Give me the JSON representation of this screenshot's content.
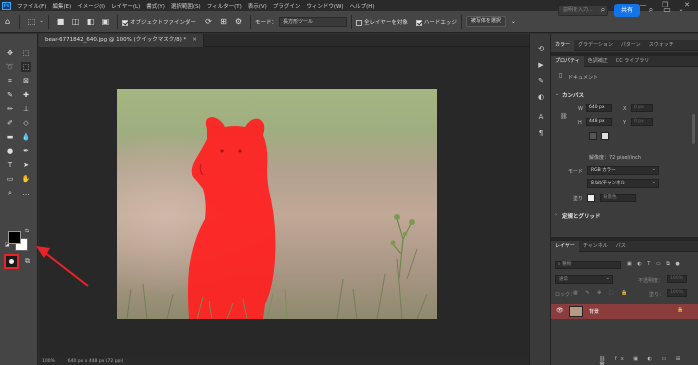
{
  "menu": {
    "logo": "Ps",
    "items": [
      "ファイル(F)",
      "編集(E)",
      "イメージ(I)",
      "レイヤー(L)",
      "書式(Y)",
      "選択範囲(S)",
      "フィルター(T)",
      "表示(V)",
      "プラグイン",
      "ウィンドウ(W)",
      "ヘルプ(H)"
    ]
  },
  "window_controls": [
    "—",
    "❐",
    "✕"
  ],
  "options_bar": {
    "object_finder_label": "オブジェクトファインダー",
    "mode_label": "モード：",
    "mode_value": "長方形ツール",
    "sample_all_layers_label": "全レイヤーを対象",
    "hard_edge_label": "ハードエッジ",
    "select_subject_label": "被写体を選択",
    "search_placeholder": "説明を入力...",
    "share_label": "共有"
  },
  "document": {
    "tab_title": "bear-6771842_640.jpg @ 100% (クイックマスク/8) *",
    "status_zoom": "100%",
    "status_info": "640 px x 448 px (72 ppi)"
  },
  "top_panel_tabs": [
    "カラー",
    "グラデーション",
    "パターン",
    "スウォッチ"
  ],
  "properties_tabs": [
    "プロパティ",
    "色調補正",
    "CC ライブラリ"
  ],
  "properties": {
    "doc_label": "ドキュメント",
    "canvas_heading": "カンバス",
    "w_label": "W",
    "w_value": "640 px",
    "x_label": "X",
    "x_value": "0 px",
    "h_label": "H",
    "h_value": "448 px",
    "y_label": "Y",
    "y_value": "0 px",
    "resolution": "解像度：72 pixel/inch",
    "mode_label": "モード",
    "mode_value": "RGB カラー",
    "bitdepth_value": "8 bit/チャンネル",
    "fill_label": "塗り",
    "fill_value": "背景色",
    "rulers_heading": "定規とグリッド"
  },
  "layers_tabs": [
    "レイヤー",
    "チャンネル",
    "パス"
  ],
  "layers": {
    "search_placeholder": "種類",
    "blend_mode": "通常",
    "opacity_label": "不透明度：",
    "opacity_value": "100%",
    "lock_label": "ロック：",
    "fill_label": "塗り：",
    "fill_value": "100%",
    "layer_name": "背景"
  },
  "colors": {
    "quick_mask_overlay": "#ff2020",
    "annotation_arrow": "#e8232a",
    "share_button": "#1473e6",
    "selected_layer": "#8b3c3c"
  }
}
